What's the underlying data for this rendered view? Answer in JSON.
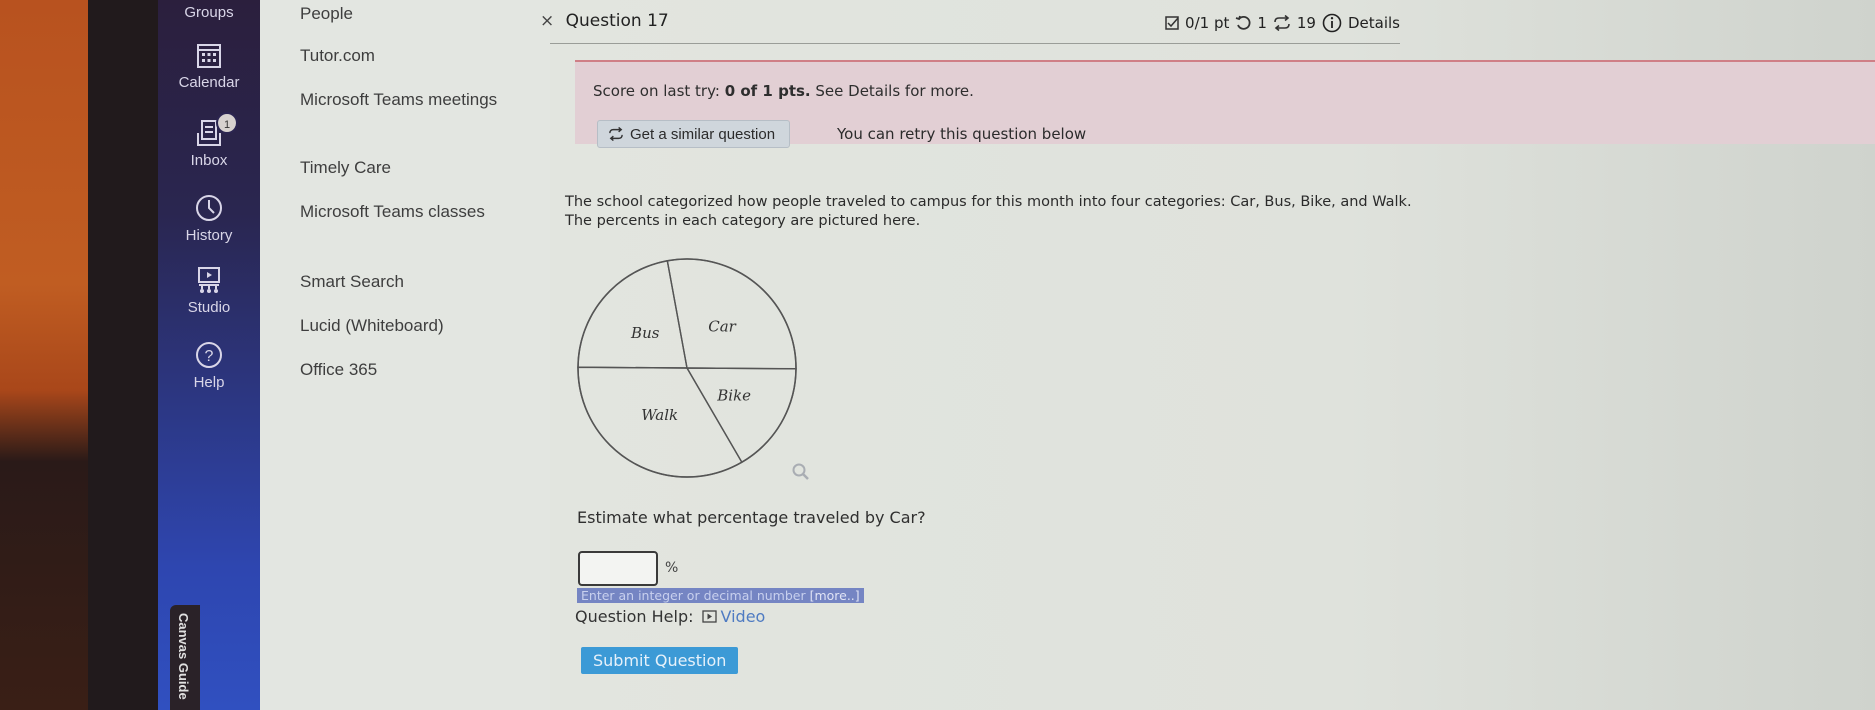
{
  "global_nav": {
    "items": [
      {
        "label": "Groups",
        "icon": "groups-icon"
      },
      {
        "label": "Calendar",
        "icon": "calendar-icon"
      },
      {
        "label": "Inbox",
        "icon": "inbox-icon",
        "badge": "1"
      },
      {
        "label": "History",
        "icon": "clock-icon"
      },
      {
        "label": "Studio",
        "icon": "studio-icon"
      },
      {
        "label": "Help",
        "icon": "help-icon"
      }
    ],
    "canvas_guide_label": "Canvas Guide"
  },
  "course_nav": {
    "items": [
      {
        "label": "People"
      },
      {
        "label": "Tutor.com"
      },
      {
        "label": "Microsoft Teams meetings"
      },
      {
        "label": "Timely Care"
      },
      {
        "label": "Microsoft Teams classes"
      },
      {
        "label": "Smart Search"
      },
      {
        "label": "Lucid (Whiteboard)"
      },
      {
        "label": "Office 365"
      }
    ]
  },
  "question": {
    "close_glyph": "×",
    "title": "Question 17",
    "points": "0/1 pt",
    "retries": "1",
    "similar_count": "19",
    "details_label": "Details"
  },
  "score_banner": {
    "prefix": "Score on last try: ",
    "score": "0 of 1 pts.",
    "suffix": " See Details for more.",
    "similar_button": "Get a similar question",
    "retry_text": "You can retry this question below"
  },
  "prompt": "The school categorized how people traveled to campus for this month into four categories: Car, Bus, Bike, and Walk. The percents in each category are pictured here.",
  "chart_data": {
    "type": "pie",
    "title": "",
    "categories": [
      "Car",
      "Bike",
      "Walk",
      "Bus"
    ],
    "values": [
      28,
      16.5,
      33.5,
      22
    ],
    "units": "%",
    "start_angle_deg": -10.4,
    "direction": "clockwise",
    "labels_shown": true,
    "values_shown": false,
    "legend": "none"
  },
  "ask": "Estimate what percentage traveled by Car?",
  "answer": {
    "value": "",
    "placeholder": "",
    "unit": "%",
    "hint": "Enter an integer or decimal number ",
    "hint_more": "[more..]"
  },
  "help": {
    "label": "Question Help:",
    "video_label": "Video"
  },
  "submit_label": "Submit Question",
  "colors": {
    "nav_top": "#2b1f3d",
    "nav_bottom": "#3050c0",
    "banner_bg": "#e2cfd4",
    "banner_border": "#cf7f86",
    "submit_bg": "#3c9ad6",
    "link": "#4f7bc2"
  }
}
